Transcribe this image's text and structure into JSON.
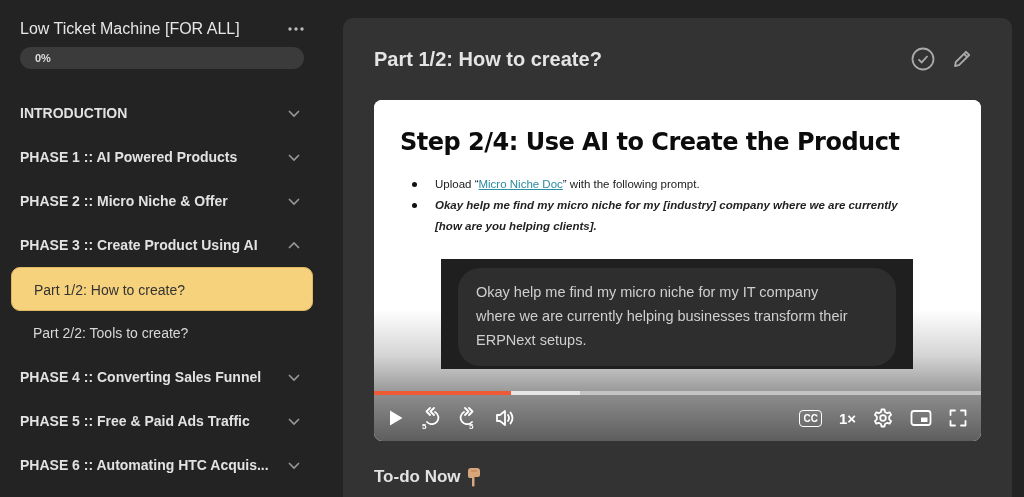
{
  "course": {
    "title": "Low Ticket Machine [FOR ALL]",
    "progress": {
      "level": 0,
      "label": "0%"
    }
  },
  "sections": [
    {
      "title": "INTRODUCTION",
      "expanded": false
    },
    {
      "title": "PHASE 1 :: AI Powered Products",
      "expanded": false
    },
    {
      "title": "PHASE 2 :: Micro Niche & Offer",
      "expanded": false
    },
    {
      "title": "PHASE 3 :: Create Product Using AI",
      "expanded": true,
      "lessons": [
        {
          "title": "Part 1/2: How to create?",
          "selected": true
        },
        {
          "title": "Part 2/2: Tools to create?",
          "selected": false
        }
      ]
    },
    {
      "title": "PHASE 4 :: Converting Sales Funnel",
      "expanded": false
    },
    {
      "title": "PHASE 5 :: Free & Paid Ads Traffic",
      "expanded": false
    },
    {
      "title": "PHASE 6 :: Automating HTC Acquis...",
      "expanded": false
    }
  ],
  "lesson": {
    "title": "Part 1/2: How to create?",
    "video": {
      "slide": {
        "heading": "Step 2/4: Use AI to Create the Product",
        "bullets": [
          {
            "kind": "link",
            "before": "Upload “",
            "link": "Micro Niche Doc",
            "after": "” with the following prompt."
          },
          {
            "kind": "emphasis",
            "text": "Okay help me find my micro niche for my [industry] company where we are currently [how are you helping clients]."
          }
        ],
        "chat": "Okay help me find my micro niche for my IT company where we are currently helping businesses transform their ERPNext setups."
      },
      "played": {
        "level": 0.226
      },
      "buffered": {
        "level": 0.34
      },
      "controls": [
        {
          "kind": "play"
        },
        {
          "kind": "rewind",
          "label": "5"
        },
        {
          "kind": "forward",
          "label": "5"
        },
        {
          "kind": "volume"
        },
        {
          "kind": "spacer"
        },
        {
          "kind": "captions",
          "label": "CC"
        },
        {
          "kind": "speed",
          "label": "1×"
        },
        {
          "kind": "settings"
        },
        {
          "kind": "pip"
        },
        {
          "kind": "fullscreen"
        }
      ]
    },
    "todo_heading": "To-do Now"
  }
}
